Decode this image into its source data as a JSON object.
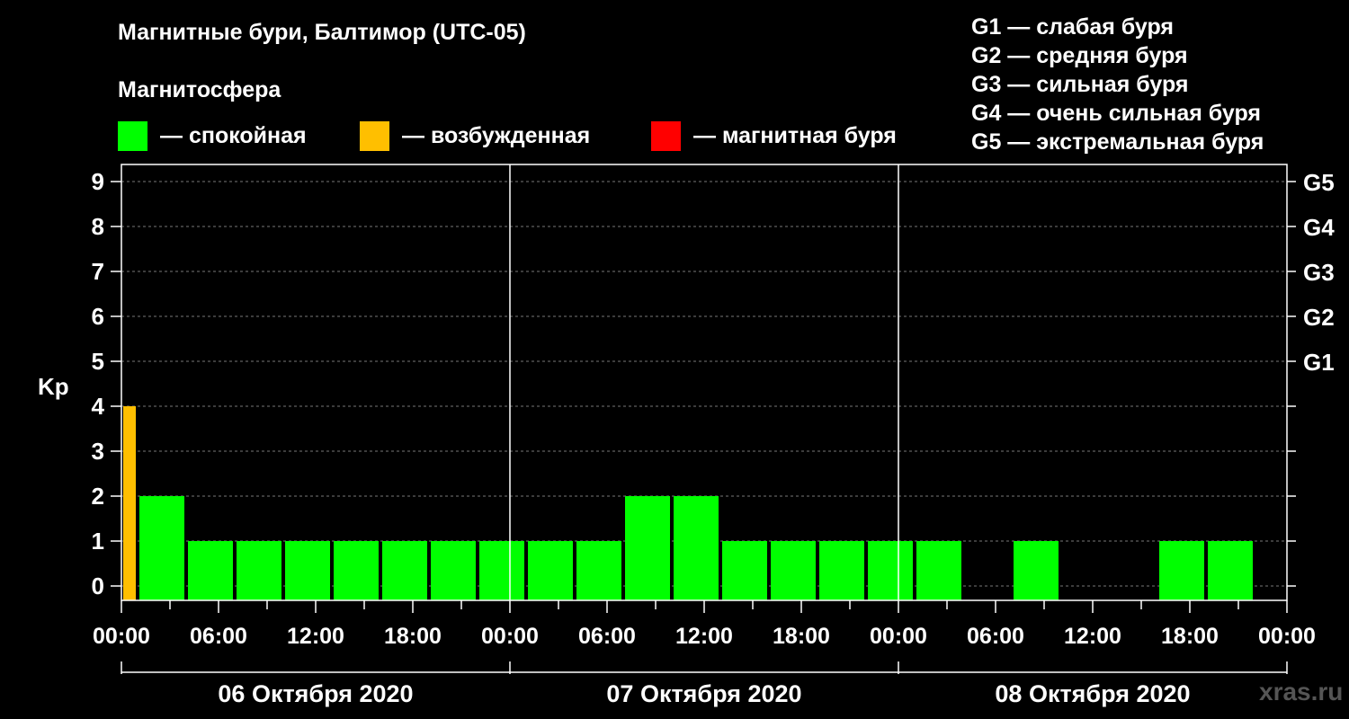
{
  "title": "Магнитные бури, Балтимор (UTC-05)",
  "subtitle": "Магнитосфера",
  "legend": [
    {
      "label": "— спокойная",
      "color": "#00ff00"
    },
    {
      "label": "— возбужденная",
      "color": "#ffbf00"
    },
    {
      "label": "— магнитная буря",
      "color": "#ff0000"
    }
  ],
  "g_legend": [
    "G1 — слабая буря",
    "G2 — средняя буря",
    "G3 — сильная буря",
    "G4 — очень сильная буря",
    "G5 — экстремальная буря"
  ],
  "watermark": "xras.ru",
  "chart_data": {
    "type": "bar",
    "ylabel": "Kp",
    "ylim": [
      0,
      9
    ],
    "yticks": [
      "0",
      "1",
      "2",
      "3",
      "4",
      "5",
      "6",
      "7",
      "8",
      "9"
    ],
    "right_ticks": [
      {
        "y": 5,
        "label": "G1"
      },
      {
        "y": 6,
        "label": "G2"
      },
      {
        "y": 7,
        "label": "G3"
      },
      {
        "y": 8,
        "label": "G4"
      },
      {
        "y": 9,
        "label": "G5"
      }
    ],
    "xlim_hours": [
      0,
      72
    ],
    "xticks": [
      "00:00",
      "06:00",
      "12:00",
      "18:00",
      "00:00",
      "06:00",
      "12:00",
      "18:00",
      "00:00",
      "06:00",
      "12:00",
      "18:00",
      "00:00"
    ],
    "days": [
      "06 Октября 2020",
      "07 Октября 2020",
      "08 Октября 2020"
    ],
    "grid": true,
    "bars": [
      {
        "start": "00:00",
        "end": "01:00",
        "kp": 4,
        "state": "возбужденная"
      },
      {
        "start": "01:00",
        "end": "04:00",
        "kp": 2,
        "state": "спокойная"
      },
      {
        "start": "04:00",
        "end": "07:00",
        "kp": 1,
        "state": "спокойная"
      },
      {
        "start": "07:00",
        "end": "10:00",
        "kp": 1,
        "state": "спокойная"
      },
      {
        "start": "10:00",
        "end": "13:00",
        "kp": 1,
        "state": "спокойная"
      },
      {
        "start": "13:00",
        "end": "16:00",
        "kp": 1,
        "state": "спокойная"
      },
      {
        "start": "16:00",
        "end": "19:00",
        "kp": 1,
        "state": "спокойная"
      },
      {
        "start": "19:00",
        "end": "22:00",
        "kp": 1,
        "state": "спокойная"
      },
      {
        "start": "22:00",
        "end": "01:00",
        "kp": 1,
        "state": "спокойная"
      },
      {
        "start": "01:00",
        "end": "04:00",
        "kp": 1,
        "state": "спокойная"
      },
      {
        "start": "04:00",
        "end": "07:00",
        "kp": 1,
        "state": "спокойная"
      },
      {
        "start": "07:00",
        "end": "10:00",
        "kp": 2,
        "state": "спокойная"
      },
      {
        "start": "10:00",
        "end": "13:00",
        "kp": 2,
        "state": "спокойная"
      },
      {
        "start": "13:00",
        "end": "16:00",
        "kp": 1,
        "state": "спокойная"
      },
      {
        "start": "16:00",
        "end": "19:00",
        "kp": 1,
        "state": "спокойная"
      },
      {
        "start": "19:00",
        "end": "22:00",
        "kp": 1,
        "state": "спокойная"
      },
      {
        "start": "22:00",
        "end": "01:00",
        "kp": 1,
        "state": "спокойная"
      },
      {
        "start": "01:00",
        "end": "04:00",
        "kp": 1,
        "state": "спокойная"
      },
      {
        "start": "04:00",
        "end": "07:00",
        "kp": 0,
        "state": "спокойная"
      },
      {
        "start": "07:00",
        "end": "10:00",
        "kp": 1,
        "state": "спокойная"
      },
      {
        "start": "10:00",
        "end": "13:00",
        "kp": 0,
        "state": "спокойная"
      },
      {
        "start": "13:00",
        "end": "16:00",
        "kp": 0,
        "state": "спокойная"
      },
      {
        "start": "16:00",
        "end": "19:00",
        "kp": 1,
        "state": "спокойная"
      },
      {
        "start": "19:00",
        "end": "22:00",
        "kp": 1,
        "state": "спокойная"
      }
    ]
  }
}
